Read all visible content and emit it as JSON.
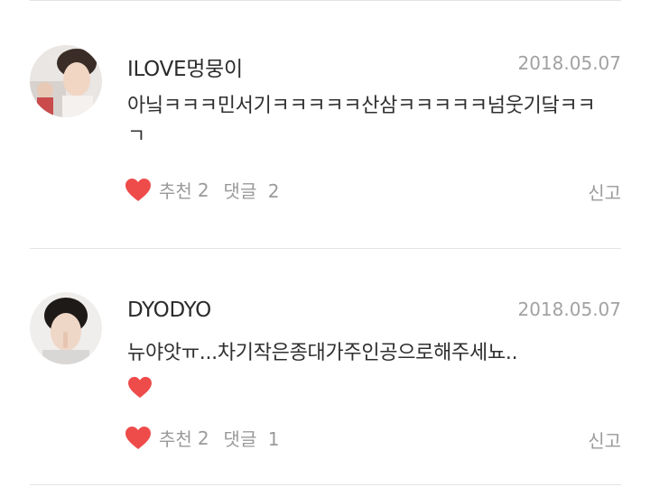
{
  "comments": [
    {
      "username": "ILOVE멍뭉이",
      "date": "2018.05.07",
      "text": "아닠ㅋㅋㅋ민서기ㅋㅋㅋㅋㅋ산삼ㅋㅋㅋㅋㅋ넘웃기닼ㅋㅋㄱ",
      "like_label": "추천",
      "like_count": "2",
      "reply_label": "댓글",
      "reply_count": "2",
      "report_label": "신고"
    },
    {
      "username": "DYODYO",
      "date": "2018.05.07",
      "text": "뉴야앗ㅠ...차기작은종대가주인공으로해주세뇨..",
      "like_label": "추천",
      "like_count": "2",
      "reply_label": "댓글",
      "reply_count": "1",
      "report_label": "신고"
    }
  ],
  "colors": {
    "heart": "#ee4b4b",
    "divider": "#e3e3e3",
    "muted": "#9a9a9a"
  }
}
